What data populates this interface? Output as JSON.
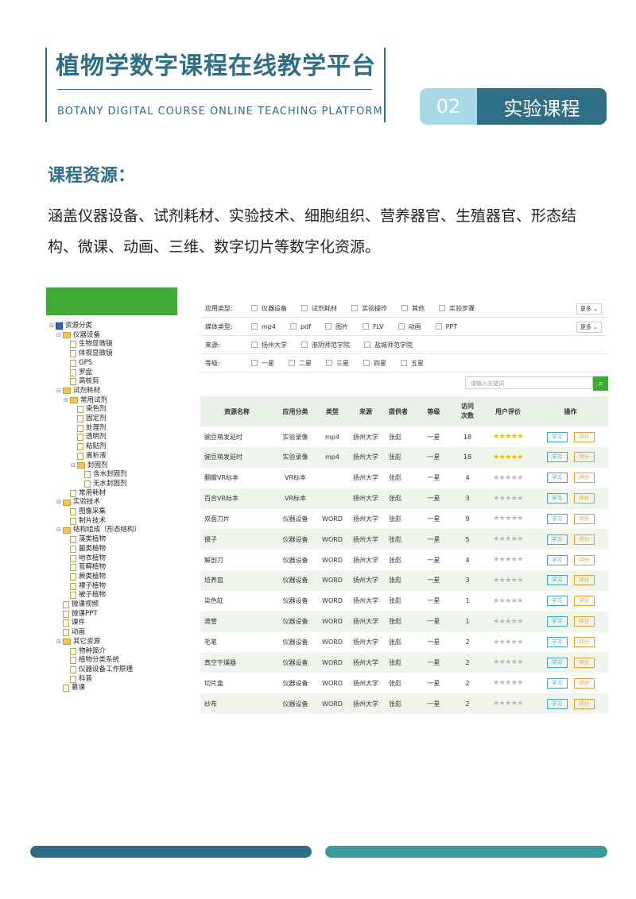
{
  "header": {
    "title": "植物学数字课程在线教学平台",
    "subtitle": "BOTANY DIGITAL COURSE ONLINE TEACHING PLATFORM",
    "badge_number": "02",
    "badge_label": "实验课程"
  },
  "section": {
    "title": "课程资源：",
    "paragraph": "涵盖仪器设备、试剂耗材、实验技术、细胞组织、营养器官、生殖器官、形态结构、微课、动画、三维、数字切片等数字化资源。"
  },
  "tree": {
    "items": [
      {
        "label": "资源分类",
        "level": 0,
        "icon": "root-icon"
      },
      {
        "label": "仪器设备",
        "level": 1,
        "icon": "folder-icon"
      },
      {
        "label": "生物显微镜",
        "level": 2,
        "icon": "file-icon"
      },
      {
        "label": "体视显微镜",
        "level": 2,
        "icon": "file-icon"
      },
      {
        "label": "GPS",
        "level": 2,
        "icon": "file-icon"
      },
      {
        "label": "罗盘",
        "level": 2,
        "icon": "file-icon"
      },
      {
        "label": "高枝剪",
        "level": 2,
        "icon": "file-icon"
      },
      {
        "label": "试剂耗材",
        "level": 1,
        "icon": "folder-icon"
      },
      {
        "label": "常用试剂",
        "level": 2,
        "icon": "folder-icon"
      },
      {
        "label": "染色剂",
        "level": 3,
        "icon": "file-icon"
      },
      {
        "label": "固定剂",
        "level": 3,
        "icon": "file-icon"
      },
      {
        "label": "处理剂",
        "level": 3,
        "icon": "file-icon"
      },
      {
        "label": "透明剂",
        "level": 3,
        "icon": "file-icon"
      },
      {
        "label": "粘贴剂",
        "level": 3,
        "icon": "file-icon"
      },
      {
        "label": "离析液",
        "level": 3,
        "icon": "file-icon"
      },
      {
        "label": "封固剂",
        "level": 3,
        "icon": "folder-icon"
      },
      {
        "label": "含水封固剂",
        "level": 4,
        "icon": "file-icon"
      },
      {
        "label": "无水封固剂",
        "level": 4,
        "icon": "file-icon"
      },
      {
        "label": "常用耗材",
        "level": 2,
        "icon": "file-icon"
      },
      {
        "label": "实验技术",
        "level": 1,
        "icon": "folder-icon"
      },
      {
        "label": "图像采集",
        "level": 2,
        "icon": "file-icon"
      },
      {
        "label": "制片技术",
        "level": 2,
        "icon": "file-icon"
      },
      {
        "label": "结构组成（形态结构）",
        "level": 1,
        "icon": "folder-icon"
      },
      {
        "label": "藻类植物",
        "level": 2,
        "icon": "file-icon"
      },
      {
        "label": "菌类植物",
        "level": 2,
        "icon": "file-icon"
      },
      {
        "label": "地衣植物",
        "level": 2,
        "icon": "file-icon"
      },
      {
        "label": "苔藓植物",
        "level": 2,
        "icon": "file-icon"
      },
      {
        "label": "蕨类植物",
        "level": 2,
        "icon": "file-icon"
      },
      {
        "label": "裸子植物",
        "level": 2,
        "icon": "file-icon"
      },
      {
        "label": "被子植物",
        "level": 2,
        "icon": "file-icon"
      },
      {
        "label": "微课视频",
        "level": 1,
        "icon": "file-icon"
      },
      {
        "label": "微课PPT",
        "level": 1,
        "icon": "file-icon"
      },
      {
        "label": "课件",
        "level": 1,
        "icon": "file-icon"
      },
      {
        "label": "动画",
        "level": 1,
        "icon": "file-icon"
      },
      {
        "label": "其它资源",
        "level": 1,
        "icon": "folder-icon"
      },
      {
        "label": "物种简介",
        "level": 2,
        "icon": "file-icon"
      },
      {
        "label": "植物分类系统",
        "level": 2,
        "icon": "file-icon"
      },
      {
        "label": "仪器设备工作原理",
        "level": 2,
        "icon": "file-icon"
      },
      {
        "label": "科普",
        "level": 2,
        "icon": "file-icon"
      },
      {
        "label": "慕课",
        "level": 1,
        "icon": "file-icon"
      }
    ]
  },
  "filters": [
    {
      "label": "应用类型:",
      "options": [
        "仪器设备",
        "试剂耗材",
        "实验操作",
        "其他",
        "实验步骤"
      ],
      "more": "更多"
    },
    {
      "label": "媒体类型:",
      "options": [
        "mp4",
        "pdf",
        "图片",
        "FLV",
        "动画",
        "PPT"
      ],
      "more": "更多"
    },
    {
      "label": "来源:",
      "options": [
        "扬州大学",
        "淮阴师范学院",
        "盐城师范学院"
      ],
      "more": ""
    },
    {
      "label": "等级:",
      "options": [
        "一星",
        "二星",
        "三星",
        "四星",
        "五星"
      ],
      "more": ""
    }
  ],
  "search": {
    "placeholder": "请输入关键词",
    "icon": "search-icon"
  },
  "table": {
    "headers": [
      "资源名称",
      "应用分类",
      "类型",
      "来源",
      "提供者",
      "等级",
      "访问次数",
      "用户评价",
      "操作"
    ],
    "learn_label": "学习",
    "rate_label": "评分",
    "rows": [
      {
        "name": "豌豆萌发延时",
        "category": "实验录像",
        "type": "mp4",
        "source": "扬州大学",
        "provider": "张彪",
        "level": "一星",
        "visits": "18",
        "rating": 5
      },
      {
        "name": "豌豆萌发延时",
        "category": "实验录像",
        "type": "mp4",
        "source": "扬州大学",
        "provider": "张彪",
        "level": "一星",
        "visits": "18",
        "rating": 5
      },
      {
        "name": "翻瓣VR标本",
        "category": "VR标本",
        "type": "",
        "source": "扬州大学",
        "provider": "张彪",
        "level": "一星",
        "visits": "4",
        "rating": 0
      },
      {
        "name": "百合VR标本",
        "category": "VR标本",
        "type": "",
        "source": "扬州大学",
        "provider": "张彪",
        "level": "一星",
        "visits": "3",
        "rating": 0
      },
      {
        "name": "双面刀片",
        "category": "仪器设备",
        "type": "WORD",
        "source": "扬州大学",
        "provider": "张彪",
        "level": "一星",
        "visits": "9",
        "rating": 0
      },
      {
        "name": "镊子",
        "category": "仪器设备",
        "type": "WORD",
        "source": "扬州大学",
        "provider": "张彪",
        "level": "一星",
        "visits": "5",
        "rating": 0
      },
      {
        "name": "解剖刀",
        "category": "仪器设备",
        "type": "WORD",
        "source": "扬州大学",
        "provider": "张彪",
        "level": "一星",
        "visits": "4",
        "rating": 0
      },
      {
        "name": "培养皿",
        "category": "仪器设备",
        "type": "WORD",
        "source": "扬州大学",
        "provider": "张彪",
        "level": "一星",
        "visits": "3",
        "rating": 0
      },
      {
        "name": "染色缸",
        "category": "仪器设备",
        "type": "WORD",
        "source": "扬州大学",
        "provider": "张彪",
        "level": "一星",
        "visits": "1",
        "rating": 0
      },
      {
        "name": "滴管",
        "category": "仪器设备",
        "type": "WORD",
        "source": "扬州大学",
        "provider": "张彪",
        "level": "一星",
        "visits": "1",
        "rating": 0
      },
      {
        "name": "毛笔",
        "category": "仪器设备",
        "type": "WORD",
        "source": "扬州大学",
        "provider": "张彪",
        "level": "一星",
        "visits": "2",
        "rating": 0
      },
      {
        "name": "真空干燥器",
        "category": "仪器设备",
        "type": "WORD",
        "source": "扬州大学",
        "provider": "张彪",
        "level": "一星",
        "visits": "2",
        "rating": 0
      },
      {
        "name": "切片盒",
        "category": "仪器设备",
        "type": "WORD",
        "source": "扬州大学",
        "provider": "张彪",
        "level": "一星",
        "visits": "2",
        "rating": 0
      },
      {
        "name": "纱布",
        "category": "仪器设备",
        "type": "WORD",
        "source": "扬州大学",
        "provider": "张彪",
        "level": "一星",
        "visits": "2",
        "rating": 0
      }
    ]
  },
  "colors": {
    "primary": "#2e6e86",
    "accent_light": "#a9d9e8",
    "green": "#3faa35",
    "teal": "#3a9a99"
  }
}
